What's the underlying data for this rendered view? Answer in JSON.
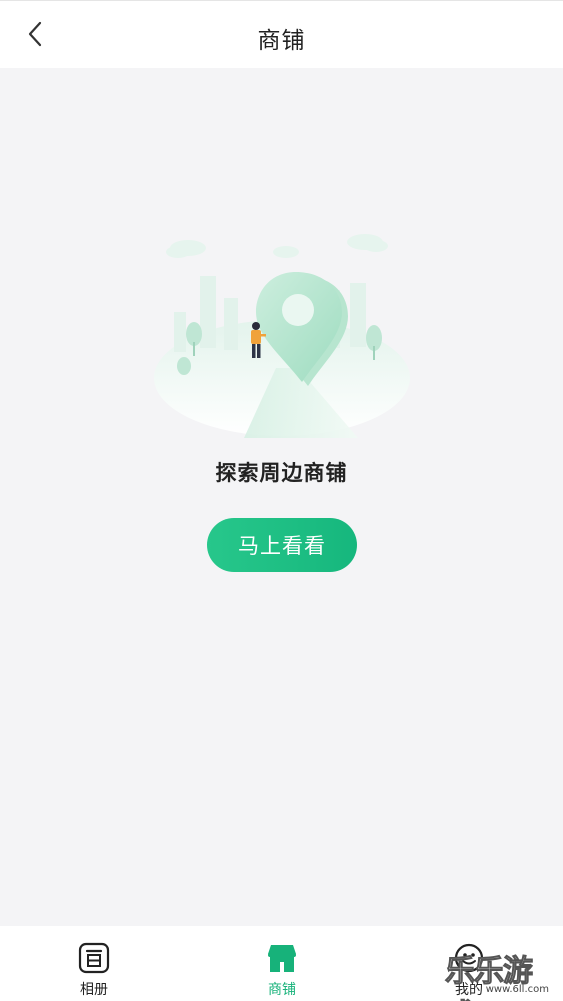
{
  "header": {
    "title": "商铺",
    "back_icon": "chevron-left-icon"
  },
  "main": {
    "illustration": "map-location-pin-illustration",
    "explore_text": "探索周边商铺",
    "cta_label": "马上看看"
  },
  "tabbar": {
    "tabs": [
      {
        "label": "相册",
        "icon": "album-icon",
        "active": false
      },
      {
        "label": "商铺",
        "icon": "shop-icon",
        "active": true
      },
      {
        "label": "我的",
        "icon": "smiley-face-icon",
        "active": false
      }
    ]
  },
  "watermark": {
    "text": "乐乐游戏",
    "url": "www.6ll.com"
  },
  "colors": {
    "accent": "#17b27a",
    "background": "#f4f4f6",
    "surface": "#ffffff"
  }
}
